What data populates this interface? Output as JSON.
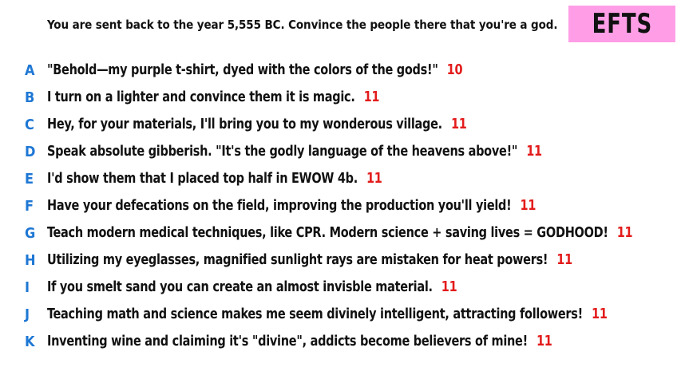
{
  "prompt": "You are sent back to the year 5,555 BC. Convince the people there that you're a god.",
  "badge": {
    "label": "EFTS",
    "color": "#ff9ee6"
  },
  "colors": {
    "letter": "#1e77d4",
    "score": "#e31b1b",
    "text": "#111111"
  },
  "entries": [
    {
      "letter": "A",
      "text": "\"Behold—my purple t-shirt, dyed with the colors of the gods!\"",
      "score": "10"
    },
    {
      "letter": "B",
      "text": "I turn on a lighter and convince them it is magic.",
      "score": "11"
    },
    {
      "letter": "C",
      "text": "Hey, for your materials, I'll bring you to my wonderous village.",
      "score": "11"
    },
    {
      "letter": "D",
      "text": "Speak absolute gibberish. \"It's the godly language of the heavens above!\"",
      "score": "11"
    },
    {
      "letter": "E",
      "text": "I'd show them that I placed top half in EWOW 4b.",
      "score": "11"
    },
    {
      "letter": "F",
      "text": "Have your defecations on the field, improving the production you'll yield!",
      "score": "11"
    },
    {
      "letter": "G",
      "text": "Teach modern medical techniques, like CPR. Modern science + saving lives = GODHOOD!",
      "score": "11"
    },
    {
      "letter": "H",
      "text": "Utilizing my eyeglasses, magnified sunlight rays are mistaken for heat powers!",
      "score": "11"
    },
    {
      "letter": "I",
      "text": "If you smelt sand you can create an almost invisble material.",
      "score": "11"
    },
    {
      "letter": "J",
      "text": "Teaching math and science makes me seem divinely intelligent, attracting followers!",
      "score": "11"
    },
    {
      "letter": "K",
      "text": "Inventing wine and claiming it's \"divine\", addicts become believers of mine!",
      "score": "11"
    }
  ]
}
